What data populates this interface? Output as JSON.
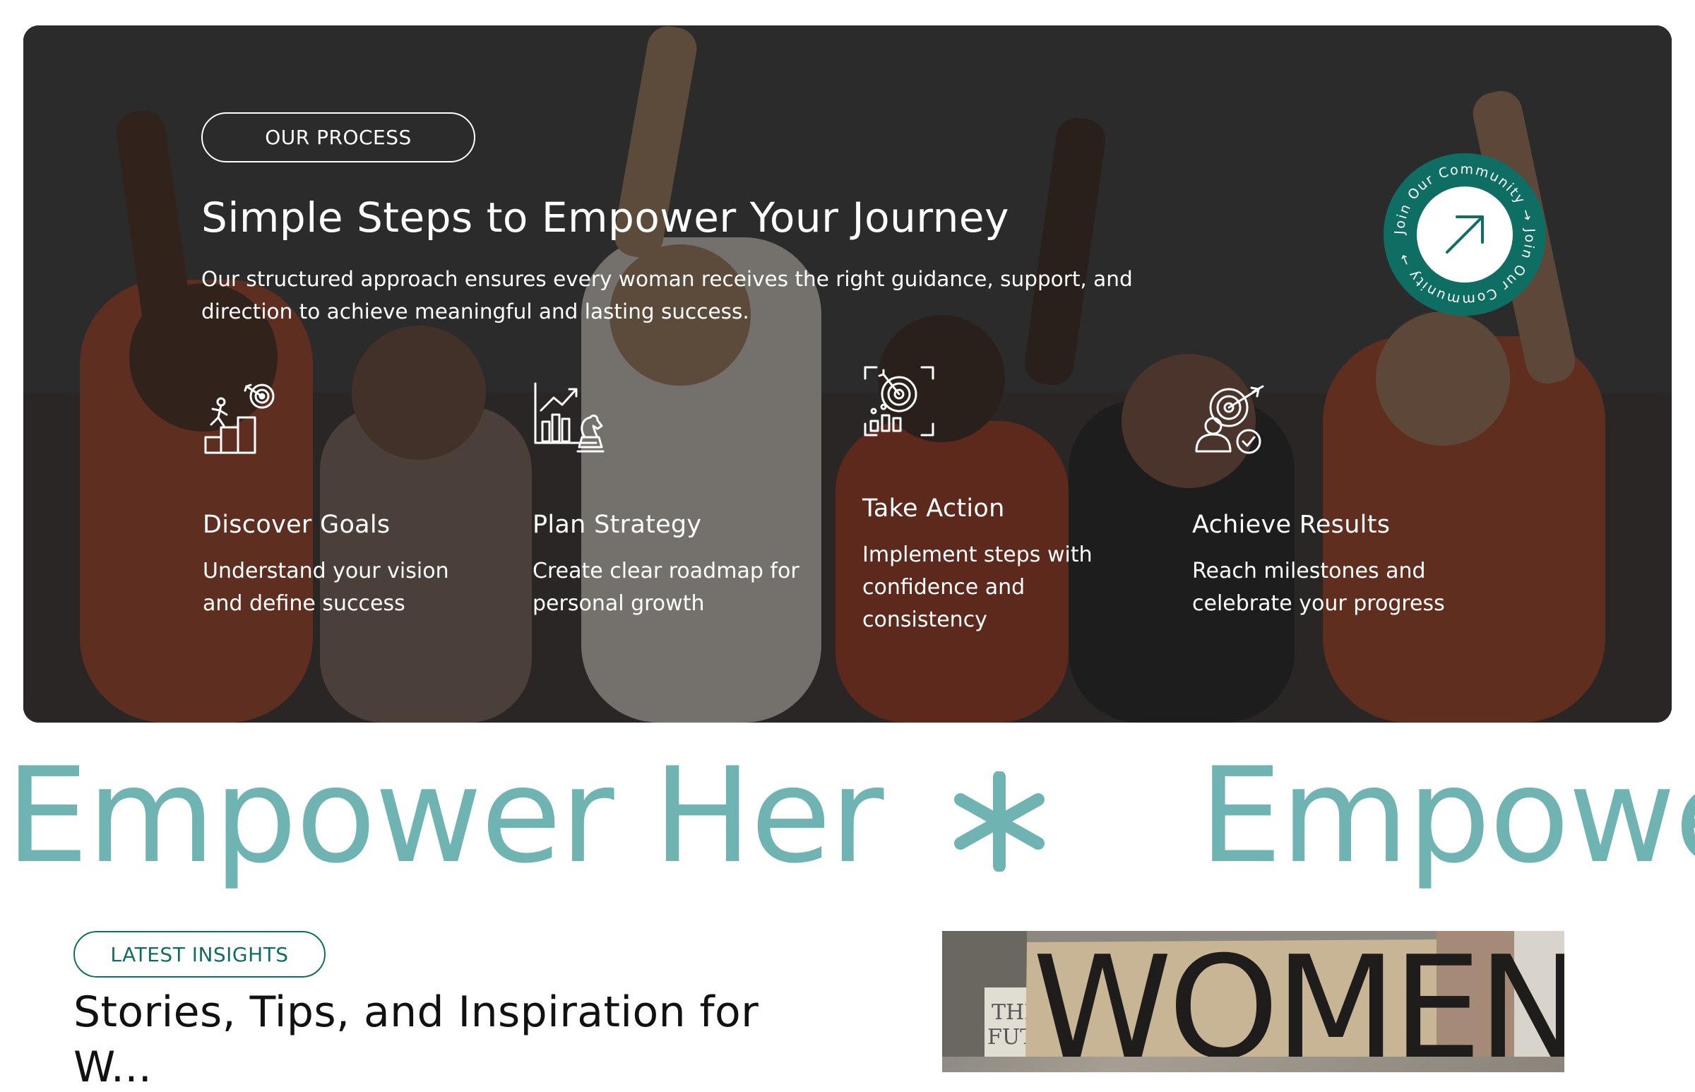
{
  "process": {
    "eyebrow": "OUR PROCESS",
    "title": "Simple Steps to Empower Your Journey",
    "description": "Our structured approach ensures every woman receives the right guidance, support, and direction to achieve meaningful and lasting success.",
    "steps": [
      {
        "icon": "goal-stairs-icon",
        "title": "Discover Goals",
        "text": "Understand your vision and define success"
      },
      {
        "icon": "growth-chart-chess-icon",
        "title": "Plan Strategy",
        "text": "Create clear roadmap for personal growth"
      },
      {
        "icon": "target-scan-icon",
        "title": "Take Action",
        "text": "Implement steps with confidence and consistency"
      },
      {
        "icon": "target-person-check-icon",
        "title": "Achieve Results",
        "text": "Reach milestones and celebrate your progress"
      }
    ],
    "badge_text": "Join Our Community → Join Our Community →"
  },
  "marquee": {
    "items": [
      "Empower Her",
      "Empowe"
    ],
    "separator_icon": "asterisk-icon"
  },
  "insights": {
    "eyebrow": "LATEST INSIGHTS",
    "title_line1": "Stories, Tips, and Inspiration for",
    "title_line2": "W...",
    "sign_text": "WOMEN"
  },
  "colors": {
    "brand_teal": "#0f6e63",
    "marquee_teal": "#6fb3b3",
    "white": "#ffffff"
  }
}
